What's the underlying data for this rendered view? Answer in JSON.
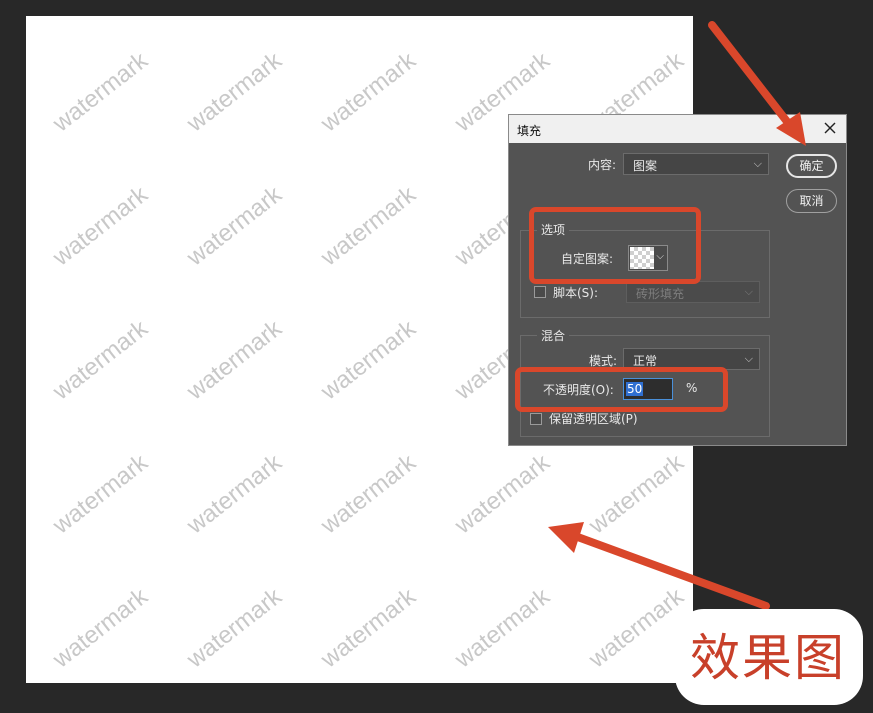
{
  "watermark_text": "watermark",
  "dialog": {
    "title": "填充",
    "content_label": "内容:",
    "content_value": "图案",
    "ok_button": "确定",
    "cancel_button": "取消",
    "options": {
      "group_label": "选项",
      "custom_pattern_label": "自定图案:",
      "script_label": "脚本(S):",
      "script_checked": false,
      "script_value": "砖形填充"
    },
    "blending": {
      "group_label": "混合",
      "mode_label": "模式:",
      "mode_value": "正常",
      "opacity_label": "不透明度(O):",
      "opacity_value": "50",
      "opacity_unit": "%",
      "preserve_label": "保留透明区域(P)",
      "preserve_checked": false
    }
  },
  "annotation": {
    "caption": "效果图",
    "accent_color": "#d9472b"
  },
  "icons": {
    "close": "close-icon",
    "dropdown": "chevron-down-icon",
    "arrow": "arrow-annotation-icon"
  }
}
